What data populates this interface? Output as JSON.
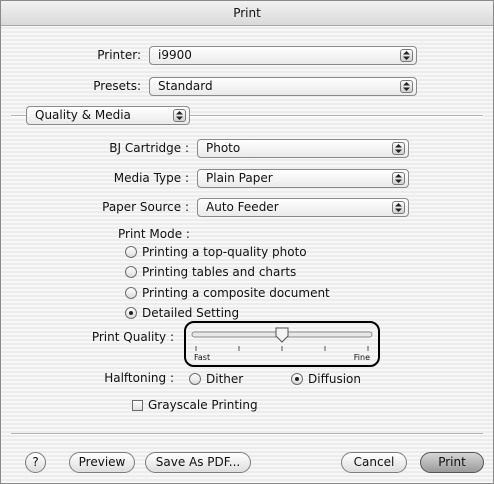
{
  "window": {
    "title": "Print"
  },
  "printer": {
    "label": "Printer:",
    "value": "i9900"
  },
  "presets": {
    "label": "Presets:",
    "value": "Standard"
  },
  "panel_menu": {
    "value": "Quality & Media"
  },
  "cartridge": {
    "label": "BJ Cartridge :",
    "value": "Photo"
  },
  "media_type": {
    "label": "Media Type :",
    "value": "Plain Paper"
  },
  "paper_source": {
    "label": "Paper Source :",
    "value": "Auto Feeder"
  },
  "print_mode": {
    "label": "Print Mode :",
    "options": [
      {
        "label": "Printing a top-quality photo",
        "selected": false
      },
      {
        "label": "Printing tables and charts",
        "selected": false
      },
      {
        "label": "Printing a composite document",
        "selected": false
      },
      {
        "label": "Detailed Setting",
        "selected": true
      }
    ]
  },
  "print_quality": {
    "label": "Print Quality :",
    "min_label": "Fast",
    "max_label": "Fine",
    "value_fraction": 0.5,
    "tick_count": 5
  },
  "halftoning": {
    "label": "Halftoning :",
    "options": [
      {
        "label": "Dither",
        "selected": false
      },
      {
        "label": "Diffusion",
        "selected": true
      }
    ]
  },
  "grayscale": {
    "label": "Grayscale Printing",
    "checked": false
  },
  "footer": {
    "help_label": "?",
    "preview_label": "Preview",
    "save_pdf_label": "Save As PDF...",
    "cancel_label": "Cancel",
    "print_label": "Print"
  }
}
